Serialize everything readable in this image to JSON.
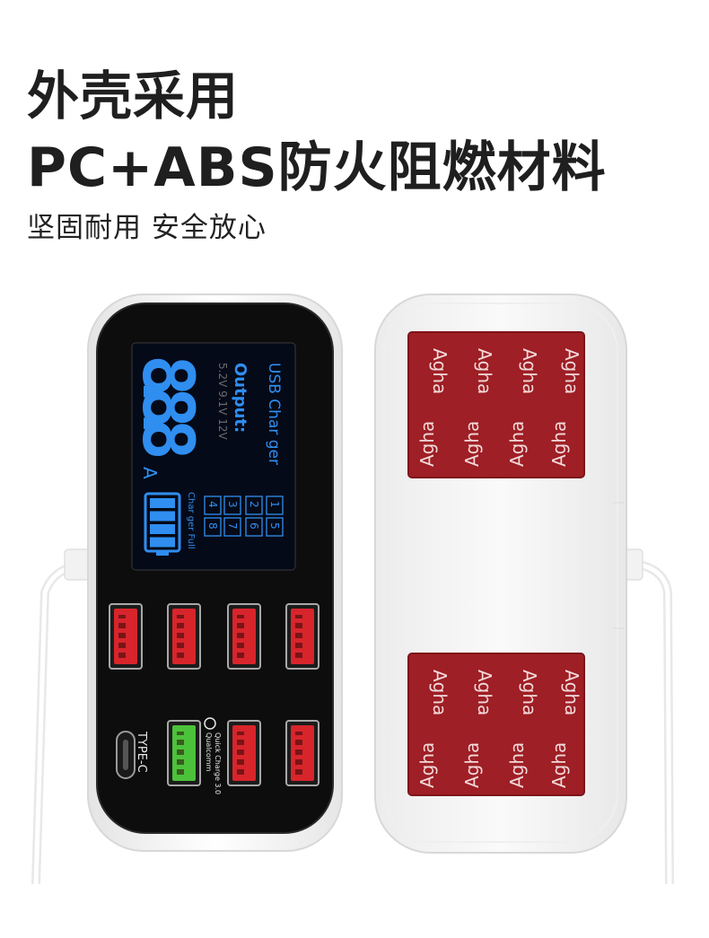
{
  "headline_line1": "外壳采用",
  "headline_line2": "PC+ABS防火阻燃材料",
  "subheadline": "坚固耐用  安全放心",
  "display": {
    "digits": "8.8.8",
    "unit": "A",
    "title": "USB Char ger",
    "output_label": "Output:",
    "voltages": "5.2V 9.1V 12V",
    "ports_row1": [
      "1",
      "2",
      "3",
      "4"
    ],
    "ports_row2": [
      "5",
      "6",
      "7",
      "8"
    ],
    "charger_full": "Char ger Full",
    "battery_level": 1.0
  },
  "type_c_label": "TYPE-C",
  "qc_line1": "Qualcomm",
  "qc_line2": "Quick Charge 3.0",
  "tape_text": "Agha",
  "colors": {
    "body_black": "#0d0d0d",
    "lcd_blue": "#2f8ef0",
    "usb_red": "#d7252b",
    "usb_green": "#4cc23a",
    "tape_red": "#9e1f25"
  }
}
